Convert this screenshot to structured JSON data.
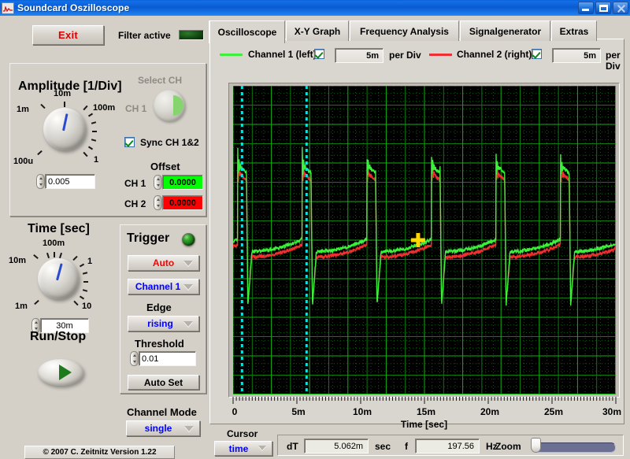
{
  "window": {
    "title": "Soundcard Oszilloscope",
    "icon": "oscilloscope-wave-icon",
    "buttons": {
      "minimize": "minimize-icon",
      "maximize": "maximize-icon",
      "close": "close-icon"
    }
  },
  "toolbar": {
    "exit_label": "Exit",
    "filter_label": "Filter active",
    "filter_led_state": "off"
  },
  "amplitude": {
    "title": "Amplitude [1/Div]",
    "knob_labels": [
      "1m",
      "10m",
      "100m",
      "1",
      "100u"
    ],
    "value": "0.005",
    "select_ch_label": "Select CH",
    "ch1_label": "CH 1",
    "sync_label": "Sync CH 1&2",
    "sync_checked": true,
    "offset_title": "Offset",
    "offset_ch1_label": "CH 1",
    "offset_ch1_value": "0.0000",
    "offset_ch2_label": "CH 2",
    "offset_ch2_value": "0.0000",
    "offset_ch1_color": "#00ff00",
    "offset_ch2_color": "#ff0000"
  },
  "time": {
    "title": "Time [sec]",
    "knob_labels": [
      "10m",
      "100m",
      "1",
      "10",
      "1m"
    ],
    "value": "30m"
  },
  "trigger": {
    "title": "Trigger",
    "led_state": "on",
    "mode": "Auto",
    "mode_color": "#ff0000",
    "source": "Channel 1",
    "source_color": "#0000ff",
    "edge_label": "Edge",
    "edge": "rising",
    "edge_color": "#0000ff",
    "threshold_label": "Threshold",
    "threshold_value": "0.01",
    "autoset_label": "Auto Set"
  },
  "runstop": {
    "label": "Run/Stop",
    "state": "running"
  },
  "channel_mode": {
    "label": "Channel Mode",
    "value": "single",
    "value_color": "#0000ff"
  },
  "copyright": "© 2007   C. Zeitnitz Version 1.22",
  "tabs": [
    {
      "label": "Oscilloscope",
      "active": true
    },
    {
      "label": "X-Y Graph",
      "active": false
    },
    {
      "label": "Frequency Analysis",
      "active": false
    },
    {
      "label": "Signalgenerator",
      "active": false
    },
    {
      "label": "Extras",
      "active": false
    }
  ],
  "channels": [
    {
      "name": "Channel 1 (left)",
      "color": "#3cf03c",
      "enabled": true,
      "per_div_value": "5m",
      "per_div_label": "per Div"
    },
    {
      "name": "Channel 2 (right)",
      "color": "#f03030",
      "enabled": true,
      "per_div_value": "5m",
      "per_div_label": "per Div"
    }
  ],
  "cursor": {
    "label": "Cursor",
    "mode": "time",
    "mode_color": "#0000ff",
    "dt_label": "dT",
    "dt_value": "5.062m",
    "dt_unit": "sec",
    "f_label": "f",
    "f_value": "197.56",
    "f_unit": "Hz",
    "zoom_label": "Zoom",
    "zoom_value": 2
  },
  "chart_data": {
    "type": "line",
    "title": "",
    "xlabel": "Time [sec]",
    "ylabel": "",
    "xlim": [
      0,
      0.03
    ],
    "ylim": [
      -0.02,
      0.02
    ],
    "xticks": [
      0,
      0.005,
      0.01,
      0.015,
      0.02,
      0.025,
      0.03
    ],
    "xticklabels": [
      "0",
      "5m",
      "10m",
      "15m",
      "20m",
      "25m",
      "30m"
    ],
    "grid": true,
    "grid_color": "#00a000",
    "background": "#000000",
    "legend_position": "top",
    "cursors": {
      "vertical_time_positions": [
        0.0007,
        0.00576
      ],
      "cursor_color": "#00e5e5",
      "marker": {
        "x": 0.0145,
        "y": 0.0,
        "color": "#ffd700",
        "shape": "cross"
      }
    },
    "series": [
      {
        "name": "Channel 1 (left)",
        "color": "#3cf03c",
        "description": "Pulse train, period ~5.06 ms: flat baseline with slow upward drift, sharp rising edge to high level with damped ringing overshoot, then sharp fall below baseline",
        "pulse_period_s": 0.00506,
        "pulse_rise_times_s": [
          0.00036,
          0.00542,
          0.01048,
          0.01554,
          0.0206,
          0.02566
        ],
        "baseline_level": -0.0015,
        "high_level": 0.0098,
        "overshoot_level": 0.0115,
        "undershoot_level": -0.0085
      },
      {
        "name": "Channel 2 (right)",
        "color": "#f03030",
        "description": "Nearly identical pulse train overlaid slightly below Channel 1",
        "pulse_period_s": 0.00506,
        "baseline_level": -0.0018,
        "high_level": 0.0093
      }
    ]
  }
}
